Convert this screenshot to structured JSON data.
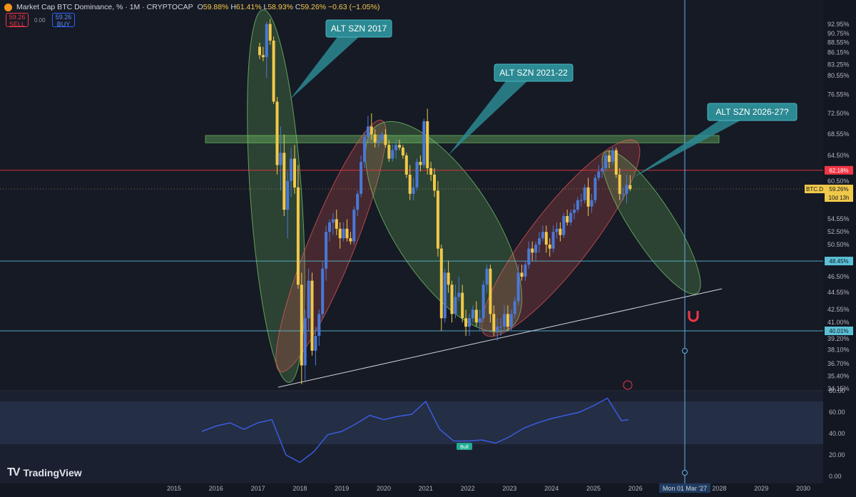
{
  "header": {
    "title": "Market Cap BTC Dominance, % · 1M · CRYPTOCAP",
    "open_label": "O",
    "open": "59.88%",
    "high_label": "H",
    "high": "61.41%",
    "low_label": "L",
    "low": "58.93%",
    "close_label": "C",
    "close": "59.26%",
    "change": "−0.63 (−1.05%)"
  },
  "trade": {
    "sell_price": "59.26",
    "sell_label": "SELL",
    "spread": "0.00",
    "buy_price": "59.26",
    "buy_label": "BUY"
  },
  "scale_unit": "%",
  "brand": "TradingView",
  "colors": {
    "background": "#161a25",
    "up_candle": "#4a78d6",
    "down_candle": "#f0c94a",
    "green_ellipse": "#7ad36b",
    "red_ellipse": "#f05a5a",
    "resistance_line": "#f23645",
    "support_line": "#5bc0d6",
    "callout": "#2b8a93",
    "rsi_line": "#3a5ce0",
    "rsi_band": "#2c3a55",
    "crosshair": "#5fb3e6"
  },
  "chart_data": [
    {
      "type": "line",
      "title": "Market Cap BTC Dominance, %",
      "series_type": "candlestick",
      "x_axis": [
        "2015",
        "2016",
        "2017",
        "2018",
        "2019",
        "2020",
        "2021",
        "2022",
        "2023",
        "2024",
        "2025",
        "2026",
        "2027",
        "2028",
        "2029",
        "2030"
      ],
      "crosshair_label": "Mon 01 Mar '27",
      "y_ticks": [
        "92.95%",
        "90.75%",
        "88.55%",
        "86.15%",
        "83.25%",
        "80.55%",
        "76.55%",
        "72.50%",
        "68.55%",
        "64.50%",
        "60.50%",
        "57.70%",
        "54.55%",
        "52.50%",
        "50.50%",
        "48.40%",
        "46.50%",
        "44.55%",
        "42.55%",
        "41.00%",
        "39.20%",
        "38.10%",
        "36.70%",
        "35.40%",
        "34.15%"
      ],
      "y_range": [
        34.15,
        95.0
      ],
      "price_labels": [
        {
          "text": "62.18%",
          "kind": "resistance"
        },
        {
          "text": "BTC.D",
          "kind": "symbol"
        },
        {
          "text": "59.26%",
          "kind": "last"
        },
        {
          "text": "10d 13h",
          "kind": "countdown"
        },
        {
          "text": "48.45%",
          "kind": "support"
        },
        {
          "text": "40.01%",
          "kind": "support"
        }
      ],
      "horizontal_levels": [
        {
          "value": 62.18,
          "color": "red"
        },
        {
          "value": 48.45,
          "color": "cyan"
        },
        {
          "value": 40.01,
          "color": "cyan"
        }
      ],
      "zone": {
        "from": 66.9,
        "to": 68.3,
        "label": ""
      },
      "annotations": [
        "ALT SZN 2017",
        "ALT SZN 2021-22",
        "ALT SZN 2026-27?"
      ],
      "ellipses": [
        {
          "period": "2017",
          "color": "green"
        },
        {
          "period": "2018-2019",
          "color": "red"
        },
        {
          "period": "2020-2022",
          "color": "green"
        },
        {
          "period": "2023-2025",
          "color": "red"
        },
        {
          "period": "2026-2027",
          "color": "green"
        }
      ],
      "candles": [
        {
          "t": "2017-01",
          "o": 87.5,
          "h": 88.5,
          "l": 84.5,
          "c": 85.5
        },
        {
          "t": "2017-02",
          "o": 85.5,
          "h": 87.5,
          "l": 84.0,
          "c": 85.0
        },
        {
          "t": "2017-03",
          "o": 85.0,
          "h": 93.5,
          "l": 80.0,
          "c": 93.0
        },
        {
          "t": "2017-04",
          "o": 93.0,
          "h": 94.0,
          "l": 88.0,
          "c": 89.0
        },
        {
          "t": "2017-05",
          "o": 89.0,
          "h": 90.0,
          "l": 74.5,
          "c": 75.0
        },
        {
          "t": "2017-06",
          "o": 75.0,
          "h": 76.0,
          "l": 61.5,
          "c": 63.0
        },
        {
          "t": "2017-07",
          "o": 63.0,
          "h": 70.0,
          "l": 59.0,
          "c": 65.0
        },
        {
          "t": "2017-08",
          "o": 65.0,
          "h": 68.5,
          "l": 55.0,
          "c": 56.0
        },
        {
          "t": "2017-09",
          "o": 56.0,
          "h": 62.0,
          "l": 51.5,
          "c": 60.5
        },
        {
          "t": "2017-10",
          "o": 60.5,
          "h": 66.0,
          "l": 58.0,
          "c": 64.0
        },
        {
          "t": "2017-11",
          "o": 64.0,
          "h": 66.5,
          "l": 58.5,
          "c": 59.5
        },
        {
          "t": "2017-12",
          "o": 59.5,
          "h": 63.0,
          "l": 45.0,
          "c": 45.5
        },
        {
          "t": "2018-01",
          "o": 45.5,
          "h": 47.0,
          "l": 34.6,
          "c": 36.5
        },
        {
          "t": "2018-02",
          "o": 36.5,
          "h": 42.5,
          "l": 35.0,
          "c": 41.5
        },
        {
          "t": "2018-03",
          "o": 41.5,
          "h": 47.5,
          "l": 40.0,
          "c": 46.0
        },
        {
          "t": "2018-04",
          "o": 46.0,
          "h": 47.0,
          "l": 37.5,
          "c": 38.0
        },
        {
          "t": "2018-05",
          "o": 38.0,
          "h": 40.5,
          "l": 36.5,
          "c": 39.5
        },
        {
          "t": "2018-06",
          "o": 39.5,
          "h": 42.5,
          "l": 38.5,
          "c": 42.0
        },
        {
          "t": "2018-07",
          "o": 42.0,
          "h": 48.5,
          "l": 41.5,
          "c": 47.5
        },
        {
          "t": "2018-08",
          "o": 47.5,
          "h": 53.5,
          "l": 46.0,
          "c": 52.5
        },
        {
          "t": "2018-09",
          "o": 52.5,
          "h": 54.5,
          "l": 51.0,
          "c": 54.0
        },
        {
          "t": "2018-10",
          "o": 54.0,
          "h": 55.5,
          "l": 52.0,
          "c": 54.5
        },
        {
          "t": "2018-11",
          "o": 54.5,
          "h": 56.0,
          "l": 52.0,
          "c": 53.0
        },
        {
          "t": "2018-12",
          "o": 53.0,
          "h": 54.0,
          "l": 50.0,
          "c": 51.5
        },
        {
          "t": "2019-01",
          "o": 51.5,
          "h": 54.0,
          "l": 51.0,
          "c": 53.0
        },
        {
          "t": "2019-02",
          "o": 53.0,
          "h": 54.5,
          "l": 51.0,
          "c": 51.5
        },
        {
          "t": "2019-03",
          "o": 51.5,
          "h": 52.5,
          "l": 50.5,
          "c": 51.0
        },
        {
          "t": "2019-04",
          "o": 51.0,
          "h": 56.5,
          "l": 50.5,
          "c": 56.0
        },
        {
          "t": "2019-05",
          "o": 56.0,
          "h": 59.0,
          "l": 55.0,
          "c": 58.5
        },
        {
          "t": "2019-06",
          "o": 58.5,
          "h": 64.5,
          "l": 58.0,
          "c": 63.5
        },
        {
          "t": "2019-07",
          "o": 63.5,
          "h": 69.0,
          "l": 62.5,
          "c": 68.0
        },
        {
          "t": "2019-08",
          "o": 68.0,
          "h": 72.0,
          "l": 67.0,
          "c": 70.0
        },
        {
          "t": "2019-09",
          "o": 70.0,
          "h": 72.5,
          "l": 67.5,
          "c": 68.5
        },
        {
          "t": "2019-10",
          "o": 68.5,
          "h": 69.5,
          "l": 66.0,
          "c": 67.0
        },
        {
          "t": "2019-11",
          "o": 67.0,
          "h": 68.5,
          "l": 66.0,
          "c": 67.5
        },
        {
          "t": "2019-12",
          "o": 67.5,
          "h": 69.0,
          "l": 67.0,
          "c": 68.5
        },
        {
          "t": "2020-01",
          "o": 68.5,
          "h": 69.5,
          "l": 66.0,
          "c": 66.5
        },
        {
          "t": "2020-02",
          "o": 66.5,
          "h": 67.5,
          "l": 63.5,
          "c": 64.0
        },
        {
          "t": "2020-03",
          "o": 64.0,
          "h": 66.5,
          "l": 63.5,
          "c": 65.5
        },
        {
          "t": "2020-04",
          "o": 65.5,
          "h": 67.5,
          "l": 64.0,
          "c": 66.5
        },
        {
          "t": "2020-05",
          "o": 66.5,
          "h": 67.5,
          "l": 65.5,
          "c": 66.0
        },
        {
          "t": "2020-06",
          "o": 66.0,
          "h": 66.5,
          "l": 64.0,
          "c": 64.5
        },
        {
          "t": "2020-07",
          "o": 64.5,
          "h": 65.0,
          "l": 61.0,
          "c": 61.5
        },
        {
          "t": "2020-08",
          "o": 61.5,
          "h": 63.0,
          "l": 57.5,
          "c": 58.5
        },
        {
          "t": "2020-09",
          "o": 58.5,
          "h": 61.0,
          "l": 57.5,
          "c": 59.5
        },
        {
          "t": "2020-10",
          "o": 59.5,
          "h": 64.0,
          "l": 59.0,
          "c": 63.5
        },
        {
          "t": "2020-11",
          "o": 63.5,
          "h": 64.5,
          "l": 62.0,
          "c": 63.0
        },
        {
          "t": "2020-12",
          "o": 63.0,
          "h": 71.5,
          "l": 62.5,
          "c": 71.0
        },
        {
          "t": "2021-01",
          "o": 71.0,
          "h": 73.5,
          "l": 61.5,
          "c": 62.5
        },
        {
          "t": "2021-02",
          "o": 62.5,
          "h": 63.5,
          "l": 60.5,
          "c": 61.5
        },
        {
          "t": "2021-03",
          "o": 61.5,
          "h": 62.5,
          "l": 58.0,
          "c": 59.0
        },
        {
          "t": "2021-04",
          "o": 59.0,
          "h": 60.5,
          "l": 49.0,
          "c": 50.0
        },
        {
          "t": "2021-05",
          "o": 50.0,
          "h": 50.5,
          "l": 40.0,
          "c": 41.5
        },
        {
          "t": "2021-06",
          "o": 41.5,
          "h": 47.5,
          "l": 41.0,
          "c": 47.0
        },
        {
          "t": "2021-07",
          "o": 47.0,
          "h": 48.5,
          "l": 44.5,
          "c": 45.5
        },
        {
          "t": "2021-08",
          "o": 45.5,
          "h": 46.0,
          "l": 41.0,
          "c": 42.0
        },
        {
          "t": "2021-09",
          "o": 42.0,
          "h": 45.5,
          "l": 41.5,
          "c": 44.0
        },
        {
          "t": "2021-10",
          "o": 44.0,
          "h": 46.5,
          "l": 43.5,
          "c": 44.5
        },
        {
          "t": "2021-11",
          "o": 44.5,
          "h": 45.5,
          "l": 41.0,
          "c": 41.5
        },
        {
          "t": "2021-12",
          "o": 41.5,
          "h": 42.5,
          "l": 39.5,
          "c": 40.5
        },
        {
          "t": "2022-01",
          "o": 40.5,
          "h": 42.0,
          "l": 39.5,
          "c": 41.5
        },
        {
          "t": "2022-02",
          "o": 41.5,
          "h": 43.0,
          "l": 41.0,
          "c": 42.5
        },
        {
          "t": "2022-03",
          "o": 42.5,
          "h": 43.5,
          "l": 40.5,
          "c": 41.0
        },
        {
          "t": "2022-04",
          "o": 41.0,
          "h": 42.5,
          "l": 40.0,
          "c": 41.5
        },
        {
          "t": "2022-05",
          "o": 41.5,
          "h": 46.0,
          "l": 41.0,
          "c": 45.5
        },
        {
          "t": "2022-06",
          "o": 45.5,
          "h": 48.0,
          "l": 44.5,
          "c": 47.5
        },
        {
          "t": "2022-07",
          "o": 47.5,
          "h": 48.0,
          "l": 41.0,
          "c": 42.0
        },
        {
          "t": "2022-08",
          "o": 42.0,
          "h": 43.0,
          "l": 39.5,
          "c": 40.0
        },
        {
          "t": "2022-09",
          "o": 40.0,
          "h": 41.5,
          "l": 39.0,
          "c": 40.5
        },
        {
          "t": "2022-10",
          "o": 40.5,
          "h": 41.5,
          "l": 39.5,
          "c": 40.5
        },
        {
          "t": "2022-11",
          "o": 40.5,
          "h": 43.0,
          "l": 40.0,
          "c": 42.0
        },
        {
          "t": "2022-12",
          "o": 42.0,
          "h": 43.0,
          "l": 40.0,
          "c": 40.5
        },
        {
          "t": "2023-01",
          "o": 40.5,
          "h": 42.5,
          "l": 40.0,
          "c": 42.0
        },
        {
          "t": "2023-02",
          "o": 42.0,
          "h": 44.0,
          "l": 41.5,
          "c": 43.5
        },
        {
          "t": "2023-03",
          "o": 43.5,
          "h": 48.0,
          "l": 43.0,
          "c": 47.0
        },
        {
          "t": "2023-04",
          "o": 47.0,
          "h": 48.0,
          "l": 46.0,
          "c": 46.5
        },
        {
          "t": "2023-05",
          "o": 46.5,
          "h": 48.5,
          "l": 46.0,
          "c": 48.0
        },
        {
          "t": "2023-06",
          "o": 48.0,
          "h": 51.0,
          "l": 47.5,
          "c": 50.0
        },
        {
          "t": "2023-07",
          "o": 50.0,
          "h": 51.0,
          "l": 48.5,
          "c": 49.5
        },
        {
          "t": "2023-08",
          "o": 49.5,
          "h": 51.0,
          "l": 48.5,
          "c": 50.5
        },
        {
          "t": "2023-09",
          "o": 50.5,
          "h": 52.5,
          "l": 49.5,
          "c": 51.5
        },
        {
          "t": "2023-10",
          "o": 51.5,
          "h": 53.5,
          "l": 51.0,
          "c": 52.5
        },
        {
          "t": "2023-11",
          "o": 52.5,
          "h": 53.5,
          "l": 49.5,
          "c": 50.5
        },
        {
          "t": "2023-12",
          "o": 50.5,
          "h": 51.5,
          "l": 49.0,
          "c": 50.0
        },
        {
          "t": "2024-01",
          "o": 50.0,
          "h": 53.5,
          "l": 49.5,
          "c": 52.5
        },
        {
          "t": "2024-02",
          "o": 52.5,
          "h": 54.0,
          "l": 51.5,
          "c": 53.0
        },
        {
          "t": "2024-03",
          "o": 53.0,
          "h": 54.0,
          "l": 51.0,
          "c": 52.0
        },
        {
          "t": "2024-04",
          "o": 52.0,
          "h": 55.5,
          "l": 51.5,
          "c": 55.0
        },
        {
          "t": "2024-05",
          "o": 55.0,
          "h": 56.0,
          "l": 53.5,
          "c": 54.0
        },
        {
          "t": "2024-06",
          "o": 54.0,
          "h": 56.0,
          "l": 53.5,
          "c": 55.5
        },
        {
          "t": "2024-07",
          "o": 55.5,
          "h": 57.0,
          "l": 54.5,
          "c": 56.0
        },
        {
          "t": "2024-08",
          "o": 56.0,
          "h": 58.0,
          "l": 55.5,
          "c": 57.5
        },
        {
          "t": "2024-09",
          "o": 57.5,
          "h": 58.5,
          "l": 56.5,
          "c": 57.5
        },
        {
          "t": "2024-10",
          "o": 57.5,
          "h": 60.0,
          "l": 57.0,
          "c": 59.5
        },
        {
          "t": "2024-11",
          "o": 59.5,
          "h": 61.0,
          "l": 55.0,
          "c": 56.5
        },
        {
          "t": "2024-12",
          "o": 56.5,
          "h": 58.5,
          "l": 55.5,
          "c": 57.5
        },
        {
          "t": "2025-01",
          "o": 57.5,
          "h": 61.5,
          "l": 57.0,
          "c": 61.0
        },
        {
          "t": "2025-02",
          "o": 61.0,
          "h": 63.0,
          "l": 60.5,
          "c": 62.0
        },
        {
          "t": "2025-03",
          "o": 62.0,
          "h": 63.5,
          "l": 61.0,
          "c": 62.5
        },
        {
          "t": "2025-04",
          "o": 62.5,
          "h": 65.0,
          "l": 62.0,
          "c": 64.5
        },
        {
          "t": "2025-05",
          "o": 64.5,
          "h": 65.5,
          "l": 62.5,
          "c": 63.5
        },
        {
          "t": "2025-06",
          "o": 63.5,
          "h": 66.0,
          "l": 63.0,
          "c": 65.5
        },
        {
          "t": "2025-07",
          "o": 65.5,
          "h": 66.0,
          "l": 61.0,
          "c": 61.5
        },
        {
          "t": "2025-08",
          "o": 61.5,
          "h": 62.5,
          "l": 57.5,
          "c": 58.5
        },
        {
          "t": "2025-09",
          "o": 58.5,
          "h": 59.5,
          "l": 57.5,
          "c": 58.5
        },
        {
          "t": "2025-10",
          "o": 58.5,
          "h": 61.5,
          "l": 57.0,
          "c": 59.9
        },
        {
          "t": "2025-11",
          "o": 59.88,
          "h": 61.41,
          "l": 58.93,
          "c": 59.26
        }
      ]
    },
    {
      "type": "line",
      "title": "",
      "name": "RSI",
      "y_ticks": [
        "80.00",
        "60.00",
        "40.00",
        "20.00",
        "0.00"
      ],
      "y_range": [
        0,
        80
      ],
      "band": [
        30,
        70
      ],
      "marker": "Bull",
      "x": [
        "2015-09",
        "2016-01",
        "2016-05",
        "2016-09",
        "2017-01",
        "2017-05",
        "2017-09",
        "2018-01",
        "2018-05",
        "2018-09",
        "2019-01",
        "2019-05",
        "2019-09",
        "2020-01",
        "2020-05",
        "2020-09",
        "2021-01",
        "2021-05",
        "2021-09",
        "2022-01",
        "2022-05",
        "2022-09",
        "2023-01",
        "2023-05",
        "2023-09",
        "2024-01",
        "2024-05",
        "2024-09",
        "2025-01",
        "2025-05",
        "2025-09",
        "2025-11"
      ],
      "values": [
        42,
        47,
        50,
        44,
        50,
        53,
        20,
        13,
        23,
        39,
        42,
        49,
        57,
        53,
        56,
        58,
        70,
        44,
        33,
        33,
        34,
        31,
        37,
        45,
        50,
        54,
        57,
        60,
        66,
        73,
        52,
        53
      ]
    }
  ]
}
